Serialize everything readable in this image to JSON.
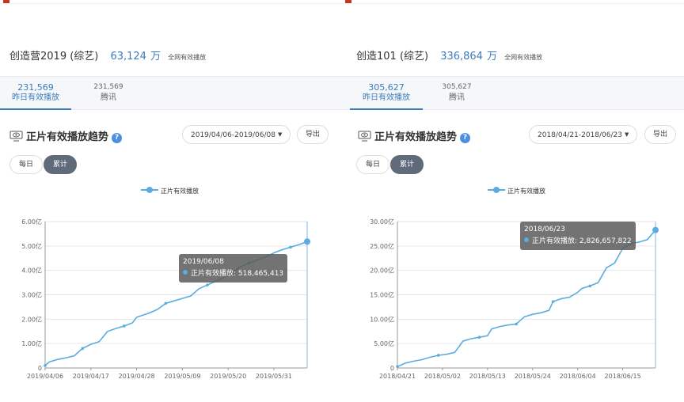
{
  "panels": [
    {
      "show_name": "创造营2019 (综艺)",
      "total_num": "63,124",
      "total_unit": "万",
      "total_label": "全网有效播放",
      "tab_active_num": "231,569",
      "tab_active_label": "昨日有效播放",
      "tab_inactive_num": "231,569",
      "tab_inactive_label": "腾讯",
      "section_title": "正片有效播放趋势",
      "date_range": "2019/04/06-2019/06/08",
      "export_label": "导出",
      "toggle_daily": "每日",
      "toggle_cumulative": "累计",
      "legend_label": "正片有效播放",
      "tooltip_date": "2019/06/08",
      "tooltip_text": "正片有效播放: 518,465,413"
    },
    {
      "show_name": "创造101 (综艺)",
      "total_num": "336,864",
      "total_unit": "万",
      "total_label": "全网有效播放",
      "tab_active_num": "305,627",
      "tab_active_label": "昨日有效播放",
      "tab_inactive_num": "305,627",
      "tab_inactive_label": "腾讯",
      "section_title": "正片有效播放趋势",
      "date_range": "2018/04/21-2018/06/23",
      "export_label": "导出",
      "toggle_daily": "每日",
      "toggle_cumulative": "累计",
      "legend_label": "正片有效播放",
      "tooltip_date": "2018/06/23",
      "tooltip_text": "正片有效播放: 2,826,657,822"
    }
  ],
  "colors": {
    "accent": "#3a7bbf",
    "series": "#5aade0",
    "toggle_active": "#5f6b7a"
  },
  "chart_data": [
    {
      "type": "line",
      "title": "正片有效播放趋势",
      "series": [
        {
          "name": "正片有效播放",
          "points": [
            [
              "2019/04/06",
              0.1
            ],
            [
              "2019/04/07",
              0.25
            ],
            [
              "2019/04/09",
              0.35
            ],
            [
              "2019/04/11",
              0.42
            ],
            [
              "2019/04/13",
              0.5
            ],
            [
              "2019/04/15",
              0.8
            ],
            [
              "2019/04/17",
              0.97
            ],
            [
              "2019/04/19",
              1.08
            ],
            [
              "2019/04/21",
              1.5
            ],
            [
              "2019/04/23",
              1.62
            ],
            [
              "2019/04/25",
              1.72
            ],
            [
              "2019/04/27",
              1.85
            ],
            [
              "2019/04/28",
              2.08
            ],
            [
              "2019/05/01",
              2.25
            ],
            [
              "2019/05/03",
              2.4
            ],
            [
              "2019/05/05",
              2.65
            ],
            [
              "2019/05/07",
              2.75
            ],
            [
              "2019/05/09",
              2.85
            ],
            [
              "2019/05/11",
              2.95
            ],
            [
              "2019/05/13",
              3.25
            ],
            [
              "2019/05/15",
              3.4
            ],
            [
              "2019/05/17",
              3.55
            ],
            [
              "2019/05/19",
              3.72
            ],
            [
              "2019/05/21",
              3.92
            ],
            [
              "2019/05/23",
              4.15
            ],
            [
              "2019/05/25",
              4.3
            ],
            [
              "2019/05/27",
              4.42
            ],
            [
              "2019/05/29",
              4.55
            ],
            [
              "2019/05/31",
              4.72
            ],
            [
              "2019/06/02",
              4.85
            ],
            [
              "2019/06/04",
              4.95
            ],
            [
              "2019/06/06",
              5.05
            ],
            [
              "2019/06/08",
              5.18
            ]
          ]
        }
      ],
      "x_ticks": [
        "2019/04/06",
        "2019/04/17",
        "2019/04/28",
        "2019/05/09",
        "2019/05/20",
        "2019/05/31"
      ],
      "y_ticks": [
        "0",
        "1.00亿",
        "2.00亿",
        "3.00亿",
        "4.00亿",
        "5.00亿",
        "6.00亿"
      ],
      "x_range": [
        "2019/04/06",
        "2019/06/08"
      ],
      "ylim": [
        0,
        6
      ],
      "y_unit": "亿",
      "grid": true,
      "legend": "top-center"
    },
    {
      "type": "line",
      "title": "正片有效播放趋势",
      "series": [
        {
          "name": "正片有效播放",
          "points": [
            [
              "2018/04/21",
              0.3
            ],
            [
              "2018/04/23",
              1.0
            ],
            [
              "2018/04/25",
              1.4
            ],
            [
              "2018/04/27",
              1.7
            ],
            [
              "2018/04/29",
              2.2
            ],
            [
              "2018/05/01",
              2.6
            ],
            [
              "2018/05/03",
              2.8
            ],
            [
              "2018/05/05",
              3.2
            ],
            [
              "2018/05/07",
              5.5
            ],
            [
              "2018/05/09",
              6.0
            ],
            [
              "2018/05/11",
              6.3
            ],
            [
              "2018/05/13",
              6.6
            ],
            [
              "2018/05/14",
              8.0
            ],
            [
              "2018/05/16",
              8.5
            ],
            [
              "2018/05/18",
              8.8
            ],
            [
              "2018/05/20",
              9.0
            ],
            [
              "2018/05/22",
              10.5
            ],
            [
              "2018/05/24",
              11.0
            ],
            [
              "2018/05/26",
              11.3
            ],
            [
              "2018/05/28",
              11.8
            ],
            [
              "2018/05/29",
              13.6
            ],
            [
              "2018/05/31",
              14.2
            ],
            [
              "2018/06/02",
              14.5
            ],
            [
              "2018/06/04",
              15.5
            ],
            [
              "2018/06/05",
              16.3
            ],
            [
              "2018/06/07",
              16.8
            ],
            [
              "2018/06/09",
              17.5
            ],
            [
              "2018/06/11",
              20.5
            ],
            [
              "2018/06/13",
              21.5
            ],
            [
              "2018/06/15",
              24.5
            ],
            [
              "2018/06/17",
              25.5
            ],
            [
              "2018/06/19",
              25.8
            ],
            [
              "2018/06/21",
              26.3
            ],
            [
              "2018/06/23",
              28.27
            ]
          ]
        }
      ],
      "x_ticks": [
        "2018/04/21",
        "2018/05/02",
        "2018/05/13",
        "2018/05/24",
        "2018/06/04",
        "2018/06/15"
      ],
      "y_ticks": [
        "0",
        "5.00亿",
        "10.00亿",
        "15.00亿",
        "20.00亿",
        "25.00亿",
        "30.00亿"
      ],
      "x_range": [
        "2018/04/21",
        "2018/06/23"
      ],
      "ylim": [
        0,
        30
      ],
      "y_unit": "亿",
      "grid": true,
      "legend": "top-center"
    }
  ]
}
